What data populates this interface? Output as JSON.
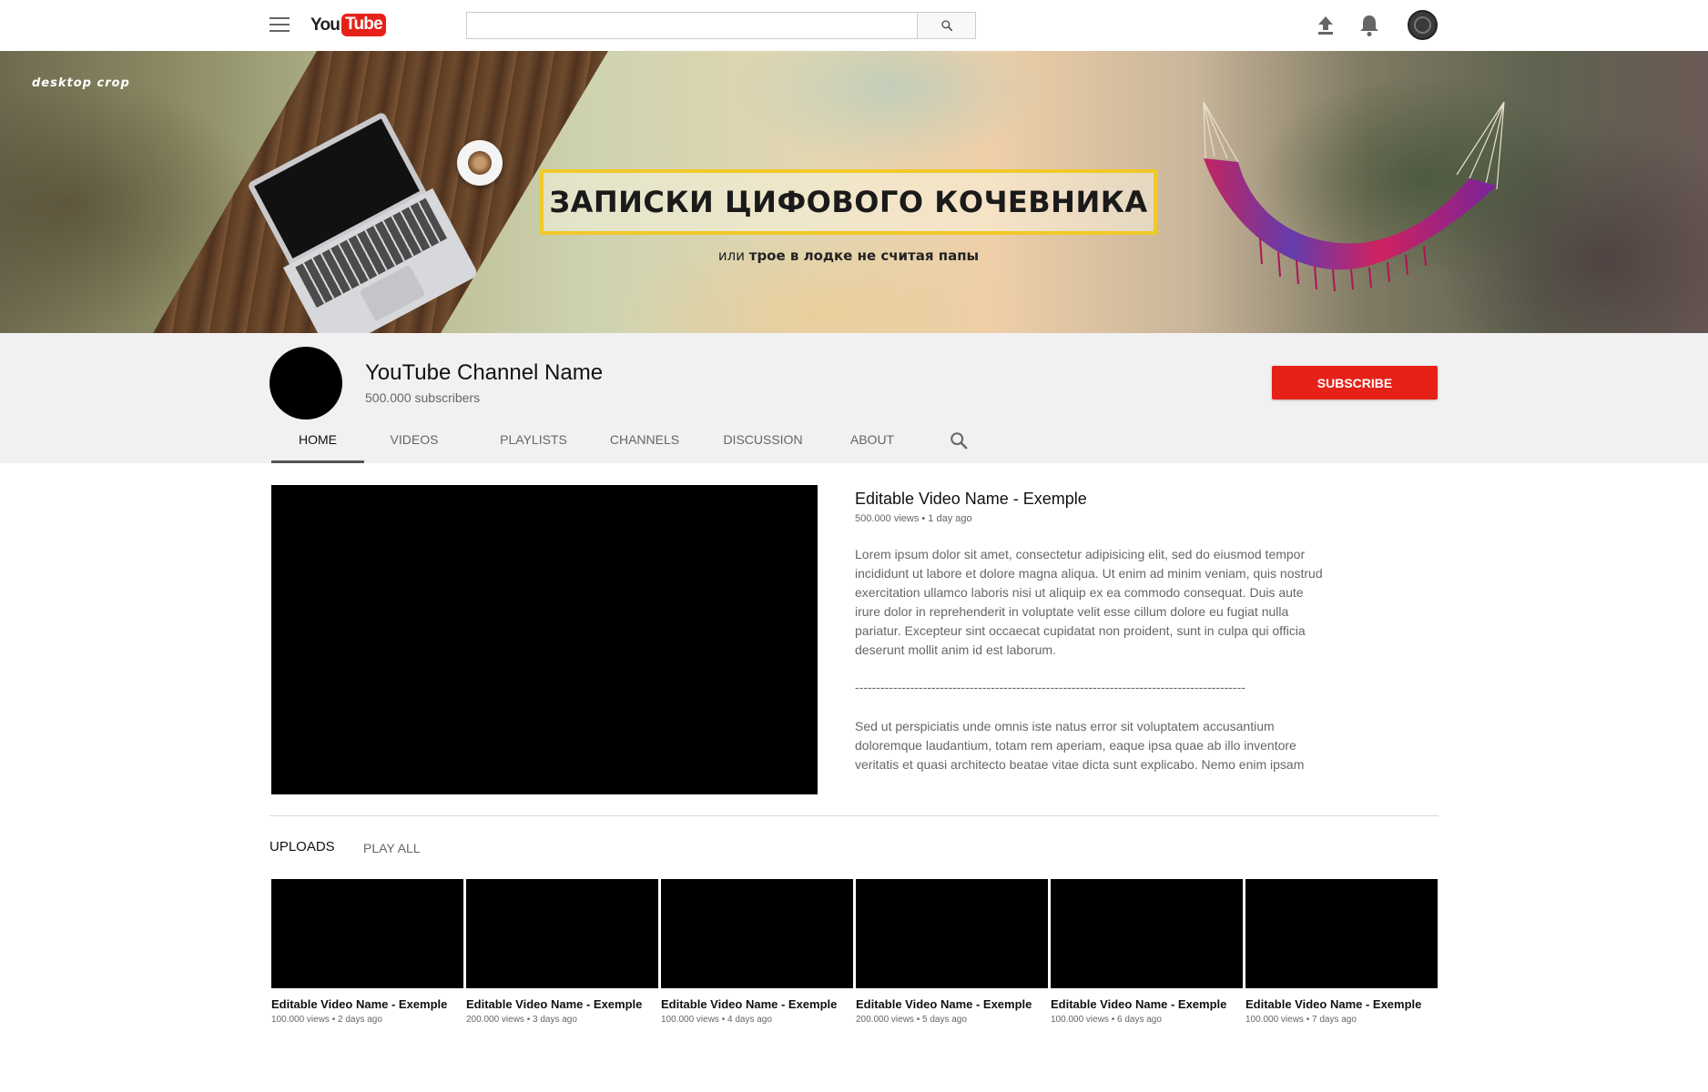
{
  "header": {
    "search_placeholder": ""
  },
  "banner": {
    "label": "desktop crop",
    "title": "ЗАПИСКИ ЦИФОВОГО КОЧЕВНИКА",
    "subtitle_prefix": "или",
    "subtitle_bold": "трое в лодке не считая папы",
    "accent_color": "#f0c92a"
  },
  "channel": {
    "name": "YouTube Channel Name",
    "subscribers": "500.000 subscribers",
    "subscribe_label": "SUBSCRIBE",
    "subscribe_color": "#e62117"
  },
  "tabs": [
    {
      "label": "HOME",
      "active": true
    },
    {
      "label": "VIDEOS",
      "active": false
    },
    {
      "label": "PLAYLISTS",
      "active": false
    },
    {
      "label": "CHANNELS",
      "active": false
    },
    {
      "label": "DISCUSSION",
      "active": false
    },
    {
      "label": "ABOUT",
      "active": false
    }
  ],
  "featured": {
    "title": "Editable Video Name - Exemple",
    "meta": "500.000 views • 1 day ago",
    "description": "Lorem ipsum dolor sit amet, consectetur adipisicing elit, sed do eiusmod tempor incididunt ut labore et dolore magna aliqua. Ut enim ad minim veniam, quis nostrud exercitation ullamco laboris nisi ut aliquip ex ea commodo consequat. Duis aute irure dolor in reprehenderit in voluptate velit esse cillum dolore eu fugiat nulla pariatur. Excepteur sint occaecat cupidatat non proident, sunt in culpa qui officia deserunt mollit anim id est laborum.",
    "divider": "--------------------------------------------------------------------------------------------",
    "description2": "Sed ut perspiciatis unde omnis iste natus error sit voluptatem accusantium doloremque laudantium, totam rem aperiam, eaque ipsa quae ab illo inventore veritatis et quasi architecto beatae vitae dicta sunt explicabo. Nemo enim ipsam"
  },
  "uploads": {
    "title": "UPLOADS",
    "play_all": "PLAY ALL",
    "videos": [
      {
        "name": "Editable Video Name - Exemple",
        "meta": "100.000 views • 2 days ago"
      },
      {
        "name": "Editable Video Name - Exemple",
        "meta": "200.000 views • 3 days ago"
      },
      {
        "name": "Editable Video Name - Exemple",
        "meta": "100.000 views • 4 days ago"
      },
      {
        "name": "Editable Video Name - Exemple",
        "meta": "200.000 views • 5 days ago"
      },
      {
        "name": "Editable Video Name - Exemple",
        "meta": "100.000 views • 6 days ago"
      },
      {
        "name": "Editable Video Name - Exemple",
        "meta": "100.000 views • 7 days ago"
      }
    ]
  },
  "icons": {
    "menu": "menu-icon",
    "search": "search-icon",
    "upload": "upload-icon",
    "notifications": "bell-icon",
    "account": "avatar"
  },
  "brand": {
    "logo_you": "You",
    "logo_tube": "Tube",
    "logo_color": "#e62117"
  }
}
